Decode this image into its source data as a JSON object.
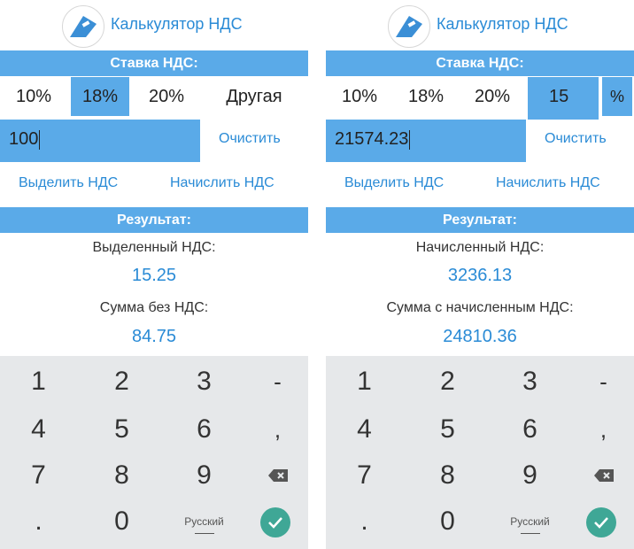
{
  "left": {
    "app_title": "Калькулятор НДС",
    "rate_header": "Ставка НДС:",
    "rates": [
      "10%",
      "18%",
      "20%",
      "Другая"
    ],
    "input_value": "100",
    "clear_label": "Очистить",
    "action_extract": "Выделить НДС",
    "action_add": "Начислить НДС",
    "result_header": "Результат:",
    "result_label_1": "Выделенный НДС:",
    "result_value_1": "15.25",
    "result_label_2": "Сумма без НДС:",
    "result_value_2": "84.75"
  },
  "right": {
    "app_title": "Калькулятор НДС",
    "rate_header": "Ставка НДС:",
    "rates": [
      "10%",
      "18%",
      "20%"
    ],
    "custom_rate": "15",
    "percent_sign": "%",
    "input_value": "21574.23",
    "clear_label": "Очистить",
    "action_extract": "Выделить НДС",
    "action_add": "Начислить НДС",
    "result_header": "Результат:",
    "result_label_1": "Начисленный НДС:",
    "result_value_1": "3236.13",
    "result_label_2": "Сумма с начисленным НДС:",
    "result_value_2": "24810.36"
  },
  "keyboard": {
    "row1": [
      "1",
      "2",
      "3",
      "-"
    ],
    "row2": [
      "4",
      "5",
      "6",
      ","
    ],
    "row3": [
      "7",
      "8",
      "9"
    ],
    "row4": [
      ".",
      "0",
      "Русский"
    ]
  },
  "colors": {
    "accent": "#5aaae8",
    "link": "#2a8bd6",
    "keyboard_bg": "#e6e8ea",
    "enter": "#3fa796"
  }
}
